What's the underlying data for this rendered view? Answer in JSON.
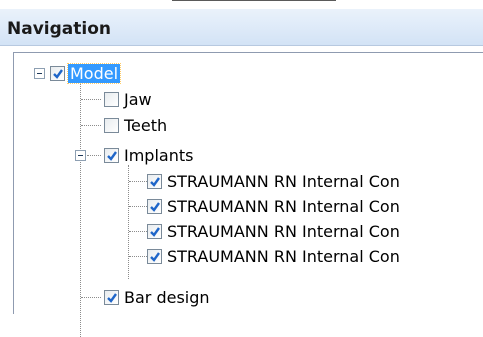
{
  "panel": {
    "title": "Navigation"
  },
  "tree": {
    "root": {
      "label": "Model",
      "checked": true,
      "expanded": true,
      "selected": true
    },
    "items": [
      {
        "label": "Jaw",
        "checked": false
      },
      {
        "label": "Teeth",
        "checked": false
      },
      {
        "label": "Implants",
        "checked": true,
        "expanded": true,
        "children": [
          {
            "label": "STRAUMANN RN Internal Con",
            "checked": true
          },
          {
            "label": "STRAUMANN RN Internal Con",
            "checked": true
          },
          {
            "label": "STRAUMANN RN Internal Con",
            "checked": true
          },
          {
            "label": "STRAUMANN RN Internal Con",
            "checked": true
          }
        ]
      },
      {
        "label": "Bar design",
        "checked": true
      }
    ]
  },
  "colors": {
    "selection": "#3399ff",
    "check": "#1f66c9",
    "header_gradient": [
      "#eaf2fb",
      "#d3e3f6"
    ]
  }
}
